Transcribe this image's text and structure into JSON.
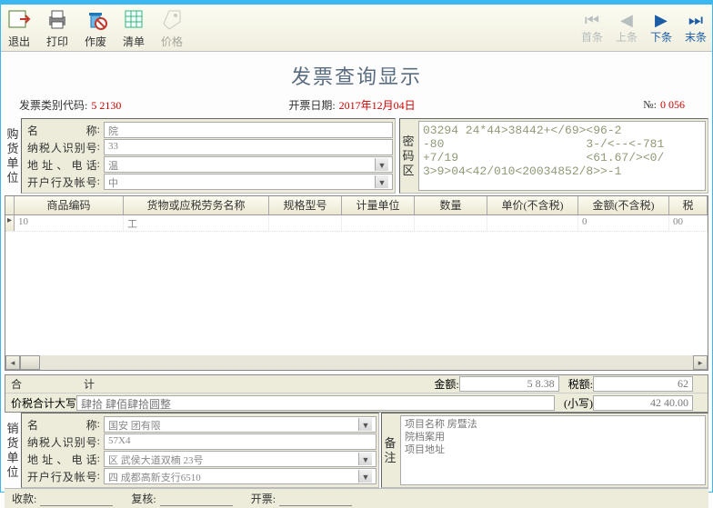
{
  "toolbar": {
    "exit": "退出",
    "print": "打印",
    "void": "作废",
    "list": "清单",
    "price": "价格",
    "first": "首条",
    "prev": "上条",
    "next": "下条",
    "last": "末条"
  },
  "title": "发票查询显示",
  "header": {
    "type_label": "发票类别代码:",
    "type_value": "5          2130",
    "date_label": "开票日期:",
    "date_value": "2017年12月04日",
    "no_label": "№:",
    "no_value": "0       056"
  },
  "buyer": {
    "title": "购货单位",
    "name_label": "名　　　称",
    "name_val": "            院",
    "taxid_label": "纳税人识别号",
    "taxid_val": "33",
    "addr_label": "地址、电话",
    "addr_val": "温",
    "bank_label": "开户行及帐号",
    "bank_val": "中"
  },
  "cipher": {
    "title": "密码区",
    "text": "03294 24*44>38442+</69><96-2\n-80                    3-/<--<-781\n+7/19                  <61.67/><0/\n3>9>04<42/010<20034852/8>>-1"
  },
  "grid": {
    "cols": [
      "商品编码",
      "货物或应税劳务名称",
      "规格型号",
      "计量单位",
      "数量",
      "单价(不含税)",
      "金额(不含税)",
      "税"
    ],
    "row1": [
      "10",
      "                 工",
      "",
      "",
      "",
      "",
      "           0",
      "        00",
      ""
    ]
  },
  "totals": {
    "sum_label": "合　　　计",
    "amount_label": "金额:",
    "amount_val": "5     8.38",
    "tax_label": "税额:",
    "tax_val": "        62",
    "cap_label": "价税合计大写",
    "cap_val": "肆拾        肆佰肆拾圆整",
    "small_label": "(小写)",
    "small_val": "42   40.00"
  },
  "seller": {
    "title": "销货单位",
    "name_label": "名　　　称",
    "name_val": "国安          团有限",
    "taxid_label": "纳税人识别号",
    "taxid_val": "          57X4",
    "addr_label": "地址、电话",
    "addr_val": "           区 武侯大道双楠           23号",
    "bank_label": "开户行及帐号",
    "bank_val": "四                    成都高新支行6510"
  },
  "notes": {
    "title": "备注",
    "text": "项目名称                                  房暨法\n院档案用\n项目地址"
  },
  "footer": {
    "payee_label": "收款:",
    "payee_val": "",
    "check_label": "复核:",
    "check_val": "",
    "issuer_label": "开票:",
    "issuer_val": ""
  }
}
